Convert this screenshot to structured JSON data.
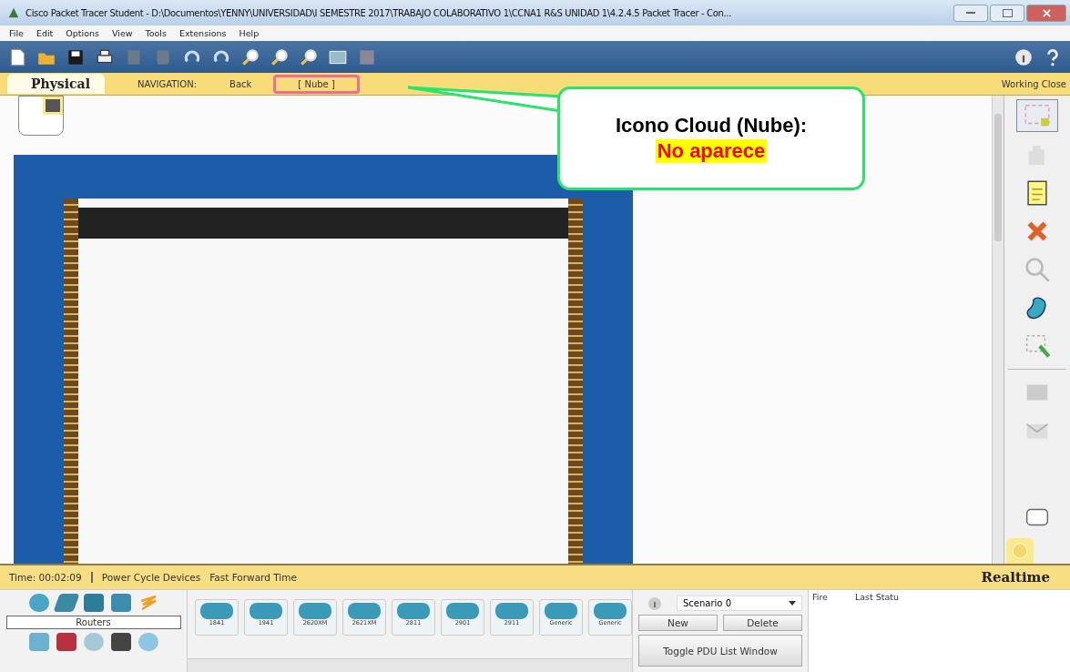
{
  "window": {
    "title": "Cisco Packet Tracer Student - D:\\Documentos\\YENNY\\UNIVERSIDAD\\I SEMESTRE 2017\\TRABAJO COLABORATIVO 1\\CCNA1 R&S UNIDAD 1\\4.2.4.5 Packet Tracer - Con..."
  },
  "menu": [
    "File",
    "Edit",
    "Options",
    "View",
    "Tools",
    "Extensions",
    "Help"
  ],
  "navigation": {
    "tab": "Physical",
    "label": "NAVIGATION:",
    "back": "Back",
    "location": "[ Nube ]",
    "right": "Working Close"
  },
  "callout": {
    "title": "Icono Cloud (Nube):",
    "highlight": "No aparece"
  },
  "status_bar": {
    "time": "Time: 00:02:09",
    "actions": [
      "Power Cycle Devices",
      "Fast Forward Time"
    ],
    "mode": "Realtime"
  },
  "device_panel": {
    "category": "Routers",
    "models": [
      "1841",
      "1941",
      "2620XM",
      "2621XM",
      "2811",
      "2901",
      "2911",
      "Generic",
      "Generic"
    ]
  },
  "scenario": {
    "name": "Scenario 0",
    "buttons": [
      "New",
      "Delete"
    ],
    "toggle": "Toggle PDU List Window"
  },
  "pdu_list": {
    "columns": [
      "Fire",
      "Last Statu"
    ]
  }
}
